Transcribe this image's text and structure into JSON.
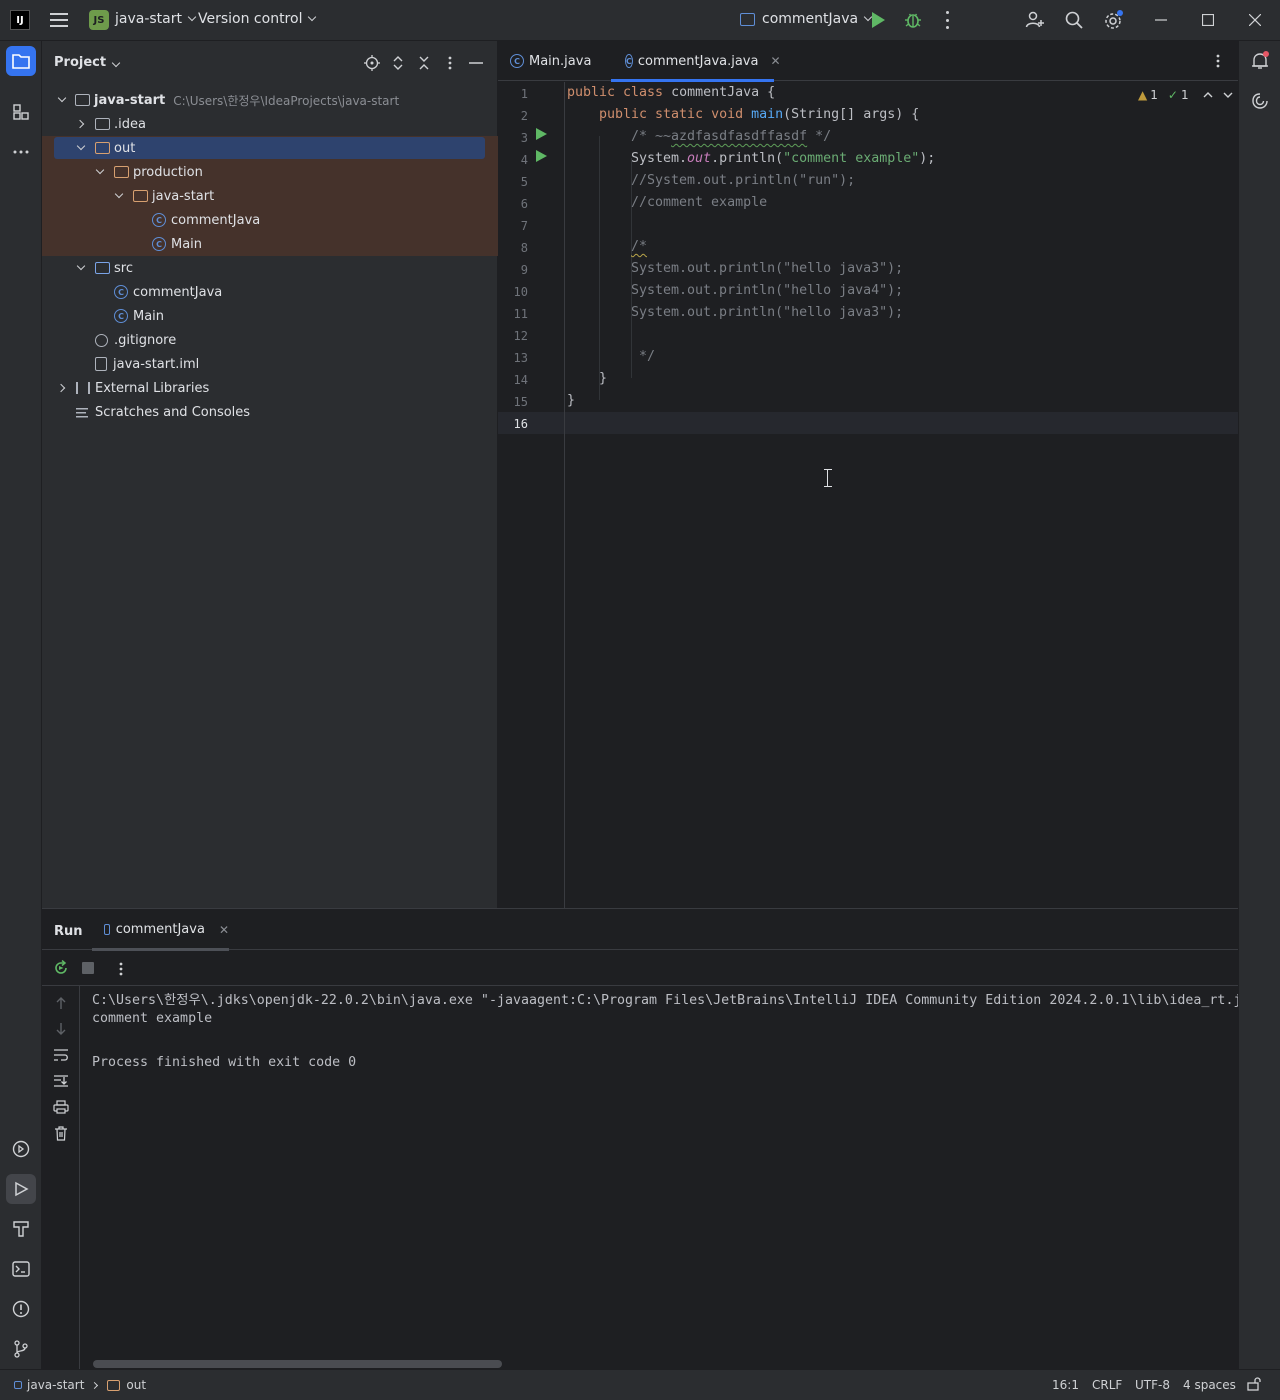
{
  "titlebar": {
    "app_logo": "IJ",
    "project_badge": "JS",
    "project_name": "java-start",
    "version_control": "Version control",
    "run_config": "commentJava",
    "icons": [
      "hamburger-menu-icon",
      "run-icon",
      "debug-icon",
      "more-icon",
      "add-user-icon",
      "search-icon",
      "settings-icon",
      "minimize-icon",
      "maximize-icon",
      "close-icon"
    ]
  },
  "project_panel": {
    "title": "Project",
    "tree": [
      {
        "label": "java-start",
        "hint": "C:\\Users\\한정우\\IdeaProjects\\java-start"
      },
      {
        "label": ".idea"
      },
      {
        "label": "out"
      },
      {
        "label": "production"
      },
      {
        "label": "java-start"
      },
      {
        "label": "commentJava"
      },
      {
        "label": "Main"
      },
      {
        "label": "src"
      },
      {
        "label": "commentJava"
      },
      {
        "label": "Main"
      },
      {
        "label": ".gitignore"
      },
      {
        "label": "java-start.iml"
      },
      {
        "label": "External Libraries"
      },
      {
        "label": "Scratches and Consoles"
      }
    ]
  },
  "editor": {
    "tabs": [
      {
        "label": "Main.java"
      },
      {
        "label": "commentJava.java"
      }
    ],
    "close_glyph": "✕",
    "inspection": {
      "warnings": "1",
      "ok": "1"
    },
    "line_numbers": [
      "1",
      "2",
      "3",
      "4",
      "5",
      "6",
      "7",
      "8",
      "9",
      "10",
      "11",
      "12",
      "13",
      "14",
      "15",
      "16"
    ],
    "code": {
      "l1_kw": "public class ",
      "l1_name": "commentJava {",
      "l2_kw": "public static void ",
      "l2_fn": "main",
      "l2_rest": "(String[] args) {",
      "l3_a": "/* ~~",
      "l3_b": "azdfasdfasdffasdf",
      "l3_c": " */",
      "l4_a": "System.",
      "l4_b": "out",
      "l4_c": ".println(",
      "l4_d": "\"comment example\"",
      "l4_e": ");",
      "l5": "//System.out.println(\"run\");",
      "l6": "//comment example",
      "l8": "/*",
      "l9": "System.out.println(\"hello java3\");",
      "l10": "System.out.println(\"hello java4\");",
      "l11": "System.out.println(\"hello java3\");",
      "l13": " */",
      "l14": "}",
      "l15": "}"
    }
  },
  "run_panel": {
    "title": "Run",
    "tab": "commentJava",
    "console": [
      "C:\\Users\\한정우\\.jdks\\openjdk-22.0.2\\bin\\java.exe \"-javaagent:C:\\Program Files\\JetBrains\\IntelliJ IDEA Community Edition 2024.2.0.1\\lib\\idea_rt.jar",
      "comment example",
      "",
      "Process finished with exit code 0"
    ]
  },
  "statusbar": {
    "breadcrumb_project": "java-start",
    "breadcrumb_folder": "out",
    "position": "16:1",
    "line_ending": "CRLF",
    "encoding": "UTF-8",
    "indent": "4 spaces"
  }
}
